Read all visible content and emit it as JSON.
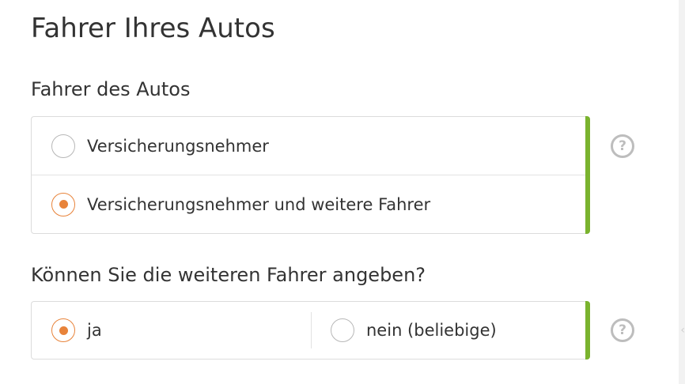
{
  "page": {
    "title": "Fahrer Ihres Autos"
  },
  "driver_section": {
    "label": "Fahrer des Autos",
    "options": [
      {
        "label": "Versicherungsnehmer",
        "selected": false
      },
      {
        "label": "Versicherungsnehmer und weitere Fahrer",
        "selected": true
      }
    ],
    "help_icon": "question-circle-icon"
  },
  "drivers_known_section": {
    "label": "Können Sie die weiteren Fahrer angeben?",
    "options": [
      {
        "label": "ja",
        "selected": true
      },
      {
        "label": "nein (beliebige)",
        "selected": false
      }
    ],
    "help_icon": "question-circle-icon"
  },
  "colors": {
    "accent_orange": "#e8833a",
    "valid_green": "#7ab32e",
    "border_gray": "#dcdcdc",
    "icon_gray": "#bdbdbd"
  }
}
